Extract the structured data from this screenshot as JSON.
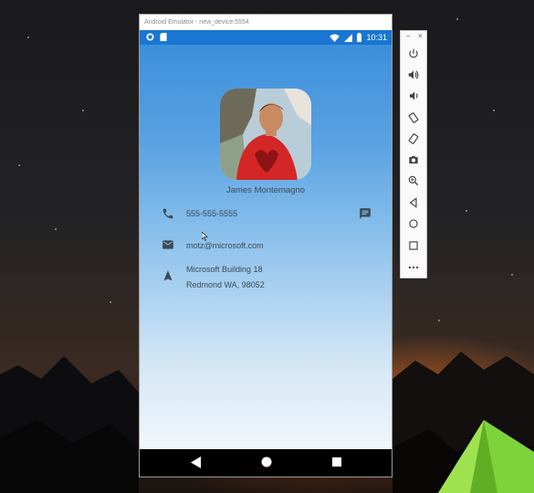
{
  "window": {
    "title": "Android Emulator - new_device:5554"
  },
  "status_bar": {
    "time": "10:31"
  },
  "profile": {
    "name": "James Montemagno",
    "phone": "555-555-5555",
    "email": "motz@microsoft.com",
    "address_line1": "Microsoft Building 18",
    "address_line2": "Redmond WA, 98052"
  },
  "toolbar": {
    "minimize_label": "–",
    "close_label": "×",
    "buttons": [
      "power-icon",
      "volume-up-icon",
      "volume-down-icon",
      "rotate-left-icon",
      "rotate-right-icon",
      "camera-icon",
      "zoom-icon",
      "back-icon",
      "home-icon",
      "overview-icon",
      "more-icon"
    ]
  },
  "colors": {
    "status_bar": "#1976d2",
    "app_top": "#3d8fdc",
    "app_bottom": "#f1f6fb",
    "text": "#3c4a56"
  }
}
